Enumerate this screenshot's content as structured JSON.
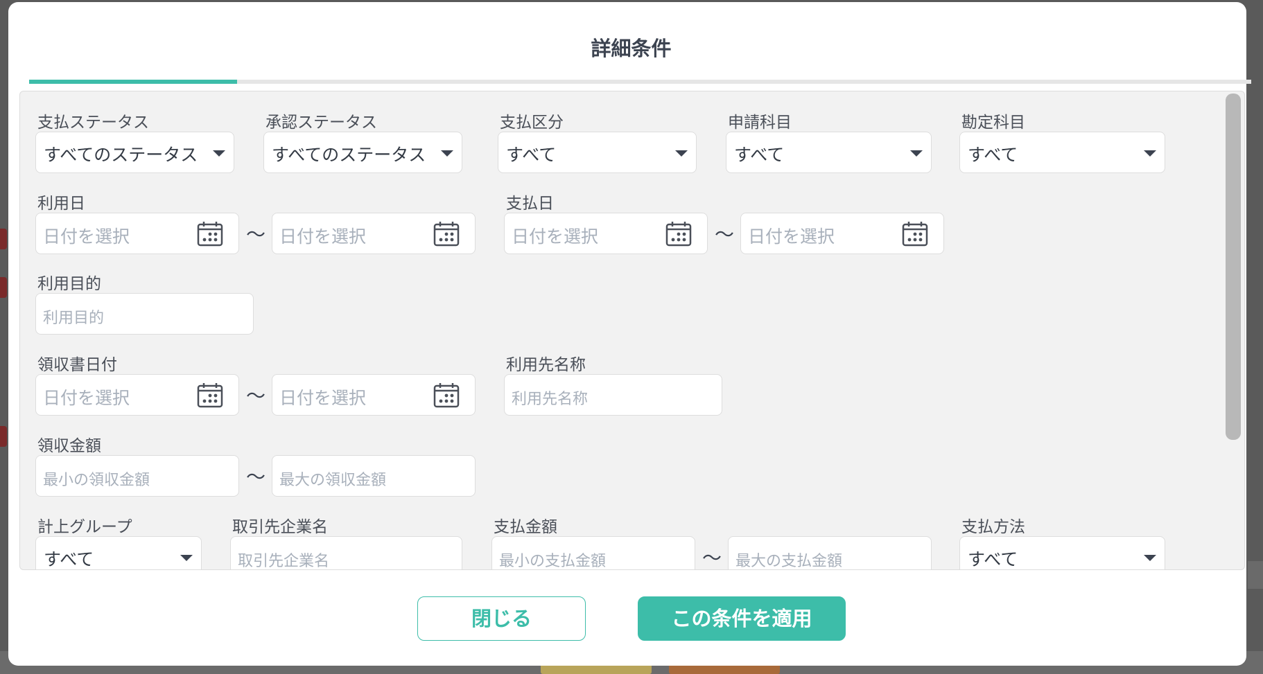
{
  "modal": {
    "title": "詳細条件",
    "progress_percent": 17
  },
  "filters": {
    "payment_status": {
      "label": "支払ステータス",
      "value": "すべてのステータス"
    },
    "approval_status": {
      "label": "承認ステータス",
      "value": "すべてのステータス"
    },
    "payment_category": {
      "label": "支払区分",
      "value": "すべて"
    },
    "application_item": {
      "label": "申請科目",
      "value": "すべて"
    },
    "account_item": {
      "label": "勘定科目",
      "value": "すべて"
    },
    "usage_date": {
      "label": "利用日",
      "from_placeholder": "日付を選択",
      "to_placeholder": "日付を選択"
    },
    "payment_date": {
      "label": "支払日",
      "from_placeholder": "日付を選択",
      "to_placeholder": "日付を選択"
    },
    "usage_purpose": {
      "label": "利用目的",
      "placeholder": "利用目的"
    },
    "receipt_date": {
      "label": "領収書日付",
      "from_placeholder": "日付を選択",
      "to_placeholder": "日付を選択"
    },
    "vendor_name": {
      "label": "利用先名称",
      "placeholder": "利用先名称"
    },
    "receipt_amount": {
      "label": "領収金額",
      "min_placeholder": "最小の領収金額",
      "max_placeholder": "最大の領収金額"
    },
    "booking_group": {
      "label": "計上グループ",
      "value": "すべて"
    },
    "partner_company": {
      "label": "取引先企業名",
      "placeholder": "取引先企業名"
    },
    "payment_amount": {
      "label": "支払金額",
      "min_placeholder": "最小の支払金額",
      "max_placeholder": "最大の支払金額"
    },
    "payment_method": {
      "label": "支払方法",
      "value": "すべて"
    },
    "range_separator": "～"
  },
  "buttons": {
    "close_label": "閉じる",
    "apply_label": "この条件を適用"
  },
  "colors": {
    "accent": "#3dbda9",
    "panel_bg": "#f2f2f2",
    "title_text": "#3c4350",
    "placeholder_text": "#a8b0bb"
  },
  "icons": {
    "select_caret": "caret-down-icon",
    "date_picker": "calendar-icon"
  }
}
